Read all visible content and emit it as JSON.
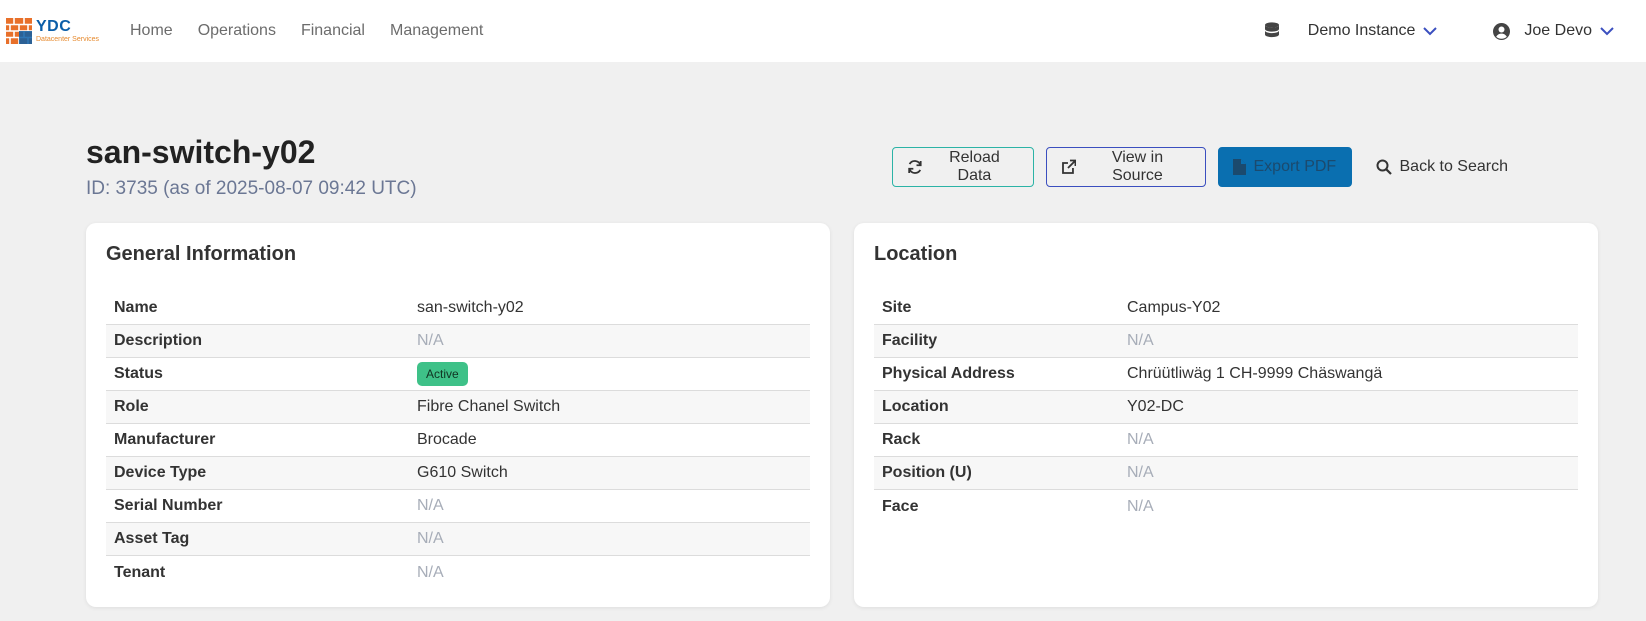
{
  "nav": {
    "logo_main": "YDC",
    "logo_sub": "Datacenter Services",
    "links": [
      "Home",
      "Operations",
      "Financial",
      "Management"
    ],
    "instance": "Demo Instance",
    "user": "Joe Devo"
  },
  "header": {
    "title": "san-switch-y02",
    "subtitle": "ID: 3735 (as of 2025-08-07 09:42 UTC)"
  },
  "actions": {
    "reload": "Reload Data",
    "source": "View in Source",
    "pdf": "Export PDF",
    "back": "Back to Search"
  },
  "general": {
    "title": "General Information",
    "rows": [
      {
        "label": "Name",
        "value": "san-switch-y02"
      },
      {
        "label": "Description",
        "value": "N/A"
      },
      {
        "label": "Status",
        "value": "Active"
      },
      {
        "label": "Role",
        "value": "Fibre Chanel Switch"
      },
      {
        "label": "Manufacturer",
        "value": "Brocade"
      },
      {
        "label": "Device Type",
        "value": "G610 Switch"
      },
      {
        "label": "Serial Number",
        "value": "N/A"
      },
      {
        "label": "Asset Tag",
        "value": "N/A"
      },
      {
        "label": "Tenant",
        "value": "N/A"
      }
    ]
  },
  "location": {
    "title": "Location",
    "rows": [
      {
        "label": "Site",
        "value": "Campus-Y02"
      },
      {
        "label": "Facility",
        "value": "N/A"
      },
      {
        "label": "Physical Address",
        "value": "Chrüütliwäg 1 CH-9999 Chäswangä"
      },
      {
        "label": "Location",
        "value": "Y02-DC"
      },
      {
        "label": "Rack",
        "value": "N/A"
      },
      {
        "label": "Position (U)",
        "value": "N/A"
      },
      {
        "label": "Face",
        "value": "N/A"
      }
    ]
  },
  "colors": {
    "accent_teal": "#2bb3a6",
    "accent_indigo": "#3b4fbf",
    "primary_blue": "#0a6fb0",
    "status_active": "#3ec188"
  }
}
